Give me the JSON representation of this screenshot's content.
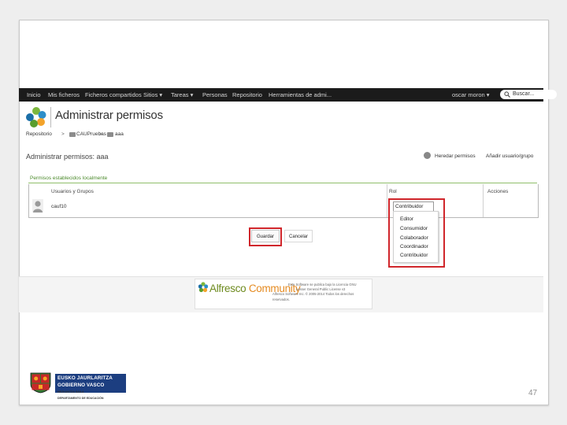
{
  "colors": {
    "highlight": "#d0262b",
    "nav_bg": "#1b1b1b",
    "set_label": "#4b8a2b"
  },
  "nav": {
    "items": [
      "Inicio",
      "Mis ficheros",
      "Ficheros compartidos",
      "Sitios ▾",
      "Tareas ▾",
      "Personas",
      "Repositorio",
      "Herramientas de admi..."
    ],
    "user": "oscar moron ▾",
    "search_placeholder": "Buscar..."
  },
  "header": {
    "title": "Administrar permisos",
    "logo": "alfresco-logo-icon"
  },
  "breadcrumb": {
    "root": "Repositorio",
    "sep": ">",
    "folder1": "CAUPruebas",
    "folder2": "aaa"
  },
  "page": {
    "subtitle": "Administrar permisos: aaa",
    "inherit_label": "Heredar permisos",
    "add_label": "Añadir usuario/grupo",
    "set_locally_label": "Permisos establecidos localmente"
  },
  "table": {
    "headers": {
      "users": "Usuarios y Grupos",
      "role": "Rol",
      "actions": "Acciones"
    },
    "rows": [
      {
        "user": "cauf10",
        "role": "Contribuidor"
      }
    ]
  },
  "role_menu": {
    "options": [
      "Editor",
      "Consumidor",
      "Colaborador",
      "Coordinador",
      "Contribuidor"
    ]
  },
  "buttons": {
    "save": "Guardar",
    "cancel": "Cancelar"
  },
  "footer": {
    "brand_a": "Alfresco",
    "brand_b": "Community",
    "license_lines": [
      "Este Software se publica bajo la Licencia GNU",
      "Lesser General Public License v3",
      "Alfresco Software Inc. © 2005-2014 Todos los derechos",
      "reservados."
    ]
  },
  "institution": {
    "line1": "EUSKO JAURLARITZA",
    "line2": "GOBIERNO VASCO",
    "line3": "HEZKUNTZA SAILA",
    "line4": "DEPARTAMENTO DE EDUCACIÓN"
  },
  "slide": {
    "page_number": "47"
  }
}
